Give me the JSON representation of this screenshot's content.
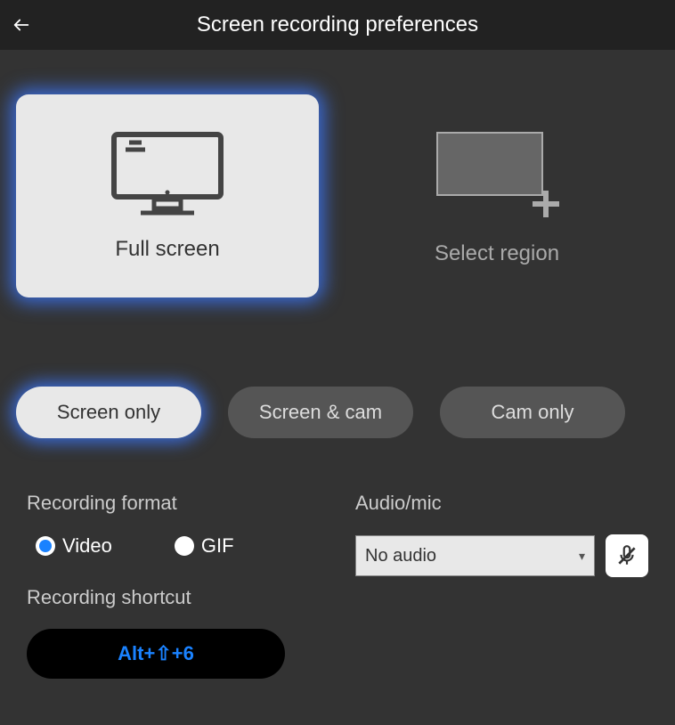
{
  "header": {
    "title": "Screen recording preferences"
  },
  "capture": {
    "full_screen": "Full screen",
    "select_region": "Select region"
  },
  "modes": {
    "screen_only": "Screen only",
    "screen_cam": "Screen & cam",
    "cam_only": "Cam only"
  },
  "format": {
    "label": "Recording format",
    "video": "Video",
    "gif": "GIF"
  },
  "shortcut": {
    "label": "Recording shortcut",
    "value": "Alt+⇧+6"
  },
  "audio": {
    "label": "Audio/mic",
    "selected": "No audio"
  }
}
